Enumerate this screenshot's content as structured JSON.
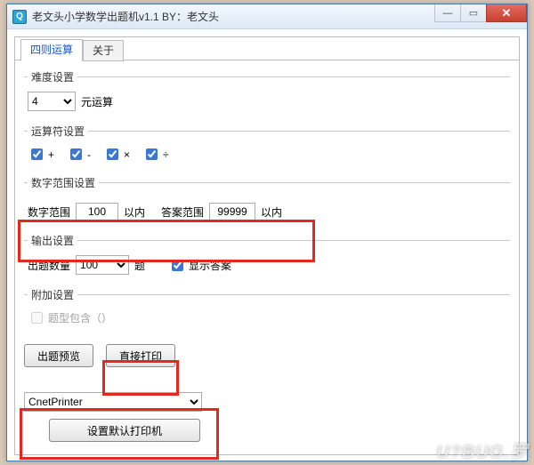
{
  "window": {
    "title": "老文头小学数学出题机v1.1    BY：老文头"
  },
  "tabs": {
    "arithmetic": "四则运算",
    "about": "关于"
  },
  "difficulty": {
    "legend": "难度设置",
    "value": "4",
    "unit": "元运算"
  },
  "operators": {
    "legend": "运算符设置",
    "plus": "+",
    "minus": "-",
    "times": "×",
    "divide": "÷"
  },
  "range": {
    "legend": "数字范围设置",
    "num_label": "数字范围",
    "num_value": "100",
    "num_suffix": "以内",
    "ans_label": "答案范围",
    "ans_value": "99999",
    "ans_suffix": "以内"
  },
  "output": {
    "legend": "输出设置",
    "count_label": "出题数量",
    "count_value": "100",
    "count_suffix": "题",
    "show_answer": "显示答案"
  },
  "addon": {
    "legend": "附加设置",
    "include": "题型包含（）"
  },
  "buttons": {
    "preview": "出题预览",
    "print": "直接打印",
    "set_default": "设置默认打印机"
  },
  "printer": {
    "selected": "CnetPrinter"
  },
  "watermark": "U?BUG.罗"
}
